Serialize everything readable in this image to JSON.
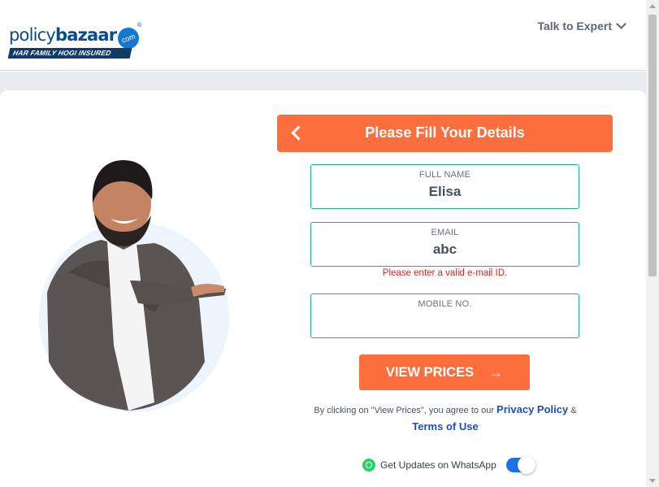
{
  "brand": {
    "name_part1": "policy",
    "name_part2": "bazaar",
    "com": "com",
    "reg": "®",
    "tagline": "HAR FAMILY HOGI INSURED"
  },
  "header": {
    "talk_label": "Talk to Expert"
  },
  "form": {
    "title": "Please Fill Your Details",
    "full_name": {
      "label": "FULL NAME",
      "value": "Elisa"
    },
    "email": {
      "label": "EMAIL",
      "value": "abc",
      "error": "Please enter a valid e-mail ID."
    },
    "mobile": {
      "label": "MOBILE NO.",
      "value": ""
    },
    "cta_label": "VIEW PRICES",
    "cta_arrow": "→"
  },
  "consent": {
    "prefix": "By clicking on \"View Prices\", you agree to our",
    "privacy": "Privacy Policy",
    "amp": "&",
    "terms": "Terms of Use"
  },
  "whatsapp": {
    "label": "Get Updates on WhatsApp",
    "enabled": true
  },
  "colors": {
    "accent": "#fd6e3d",
    "field_border": "#1db47a",
    "link": "#1d4fb8",
    "error": "#e02424",
    "toggle_on": "#1a73e8"
  }
}
